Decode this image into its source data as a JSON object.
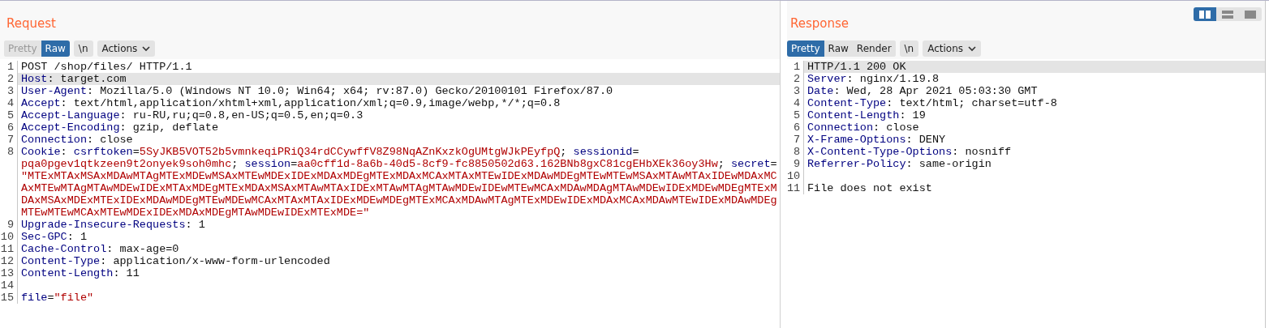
{
  "request": {
    "title": "Request",
    "tabs": [
      {
        "label": "Pretty",
        "selected": false,
        "disabled": true
      },
      {
        "label": "Raw",
        "selected": true,
        "disabled": false
      }
    ],
    "newline_button": "\\n",
    "actions_button": "Actions",
    "lines": [
      {
        "n": "1",
        "highlighted": false,
        "parts": [
          {
            "kind": "plain",
            "t": "POST /shop/files/ HTTP/1.1"
          }
        ]
      },
      {
        "n": "2",
        "highlighted": true,
        "parts": [
          {
            "kind": "name",
            "t": "Host"
          },
          {
            "kind": "plain",
            "t": ": target.com"
          }
        ]
      },
      {
        "n": "3",
        "highlighted": false,
        "parts": [
          {
            "kind": "name",
            "t": "User-Agent"
          },
          {
            "kind": "plain",
            "t": ": Mozilla/5.0 (Windows NT 10.0; Win64; x64; rv:87.0) Gecko/20100101 Firefox/87.0"
          }
        ]
      },
      {
        "n": "4",
        "highlighted": false,
        "parts": [
          {
            "kind": "name",
            "t": "Accept"
          },
          {
            "kind": "plain",
            "t": ": text/html,application/xhtml+xml,application/xml;q=0.9,image/webp,*/*;q=0.8"
          }
        ]
      },
      {
        "n": "5",
        "highlighted": false,
        "parts": [
          {
            "kind": "name",
            "t": "Accept-Language"
          },
          {
            "kind": "plain",
            "t": ": ru-RU,ru;q=0.8,en-US;q=0.5,en;q=0.3"
          }
        ]
      },
      {
        "n": "6",
        "highlighted": false,
        "parts": [
          {
            "kind": "name",
            "t": "Accept-Encoding"
          },
          {
            "kind": "plain",
            "t": ": gzip, deflate"
          }
        ]
      },
      {
        "n": "7",
        "highlighted": false,
        "parts": [
          {
            "kind": "name",
            "t": "Connection"
          },
          {
            "kind": "plain",
            "t": ": close"
          }
        ]
      },
      {
        "n": "8",
        "highlighted": false,
        "parts": [
          {
            "kind": "name",
            "t": "Cookie"
          },
          {
            "kind": "plain",
            "t": ": "
          },
          {
            "kind": "param",
            "t": "csrftoken"
          },
          {
            "kind": "plain",
            "t": "="
          },
          {
            "kind": "value",
            "t": "5SyJKB5VOT52b5vmnkeqiPRiQ34rdCCywffV8Z98NqAZnKxzkOgUMtgWJkPEyfpQ"
          },
          {
            "kind": "plain",
            "t": "; "
          },
          {
            "kind": "param",
            "t": "sessionid"
          },
          {
            "kind": "plain",
            "t": "= "
          },
          {
            "kind": "value",
            "t": "pqa0pgev1qtkzeen9t2onyek9soh0mhc"
          },
          {
            "kind": "plain",
            "t": "; "
          },
          {
            "kind": "param",
            "t": "session"
          },
          {
            "kind": "plain",
            "t": "="
          },
          {
            "kind": "value",
            "t": "aa0cff1d-8a6b-40d5-8cf9-fc8850502d63.162BNb8gxC81cgEHbXEk36oy3Hw"
          },
          {
            "kind": "plain",
            "t": "; "
          },
          {
            "kind": "param",
            "t": "secret"
          },
          {
            "kind": "plain",
            "t": "= "
          },
          {
            "kind": "value",
            "t": "\"MTExMTAxMSAxMDAwMTAgMTExMDEwMSAxMTEwMDExIDExMDAxMDEgMTExMDAxMCAxMTAxMTEwIDExMDAwMDEgMTEwMTEwMSAxMTAwMTAxIDEwMDAxMCAxMTEwMTAgMTAwMDEwIDExMTAxMDEgMTExMDAxMSAxMTAwMTAxIDExMTAwMTAgMTAwMDEwIDEwMTEwMCAxMDAwMDAgMTAwMDEwIDExMDEwMDEgMTExMDAxMSAxMDExMTExIDExMDAwMDEgMTEwMDEwMCAxMTAxMTAxIDExMDEwMDEgMTExMCAxMDAwMTAgMTExMDEwIDExMDAxMCAxMDAwMTEwIDExMDAwMDEgMTEwMTEwMCAxMTEwMDExIDExMDAxMDEgMTAwMDEwIDExMTExMDE=\""
          }
        ]
      },
      {
        "n": "9",
        "highlighted": false,
        "parts": [
          {
            "kind": "name",
            "t": "Upgrade-Insecure-Requests"
          },
          {
            "kind": "plain",
            "t": ": 1"
          }
        ]
      },
      {
        "n": "10",
        "highlighted": false,
        "parts": [
          {
            "kind": "name",
            "t": "Sec-GPC"
          },
          {
            "kind": "plain",
            "t": ": 1"
          }
        ]
      },
      {
        "n": "11",
        "highlighted": false,
        "parts": [
          {
            "kind": "name",
            "t": "Cache-Control"
          },
          {
            "kind": "plain",
            "t": ": max-age=0"
          }
        ]
      },
      {
        "n": "12",
        "highlighted": false,
        "parts": [
          {
            "kind": "name",
            "t": "Content-Type"
          },
          {
            "kind": "plain",
            "t": ": application/x-www-form-urlencoded"
          }
        ]
      },
      {
        "n": "13",
        "highlighted": false,
        "parts": [
          {
            "kind": "name",
            "t": "Content-Length"
          },
          {
            "kind": "plain",
            "t": ": 11"
          }
        ]
      },
      {
        "n": "14",
        "highlighted": false
      },
      {
        "n": "15",
        "highlighted": false,
        "parts": [
          {
            "kind": "param",
            "t": "file"
          },
          {
            "kind": "plain",
            "t": "="
          },
          {
            "kind": "value",
            "t": "\"file\""
          }
        ]
      }
    ]
  },
  "response": {
    "title": "Response",
    "tabs": [
      {
        "label": "Pretty",
        "selected": true,
        "disabled": false
      },
      {
        "label": "Raw",
        "selected": false,
        "disabled": false
      },
      {
        "label": "Render",
        "selected": false,
        "disabled": false
      }
    ],
    "newline_button": "\\n",
    "actions_button": "Actions",
    "lines": [
      {
        "n": "1",
        "highlighted": true,
        "parts": [
          {
            "kind": "plain",
            "t": "HTTP/1.1 200 OK"
          }
        ]
      },
      {
        "n": "2",
        "highlighted": false,
        "parts": [
          {
            "kind": "name",
            "t": "Server"
          },
          {
            "kind": "plain",
            "t": ": nginx/1.19.8"
          }
        ]
      },
      {
        "n": "3",
        "highlighted": false,
        "parts": [
          {
            "kind": "name",
            "t": "Date"
          },
          {
            "kind": "plain",
            "t": ": Wed, 28 Apr 2021 05:03:30 GMT"
          }
        ]
      },
      {
        "n": "4",
        "highlighted": false,
        "parts": [
          {
            "kind": "name",
            "t": "Content-Type"
          },
          {
            "kind": "plain",
            "t": ": text/html; charset=utf-8"
          }
        ]
      },
      {
        "n": "5",
        "highlighted": false,
        "parts": [
          {
            "kind": "name",
            "t": "Content-Length"
          },
          {
            "kind": "plain",
            "t": ": 19"
          }
        ]
      },
      {
        "n": "6",
        "highlighted": false,
        "parts": [
          {
            "kind": "name",
            "t": "Connection"
          },
          {
            "kind": "plain",
            "t": ": close"
          }
        ]
      },
      {
        "n": "7",
        "highlighted": false,
        "parts": [
          {
            "kind": "name",
            "t": "X-Frame-Options"
          },
          {
            "kind": "plain",
            "t": ": DENY"
          }
        ]
      },
      {
        "n": "8",
        "highlighted": false,
        "parts": [
          {
            "kind": "name",
            "t": "X-Content-Type-Options"
          },
          {
            "kind": "plain",
            "t": ": nosniff"
          }
        ]
      },
      {
        "n": "9",
        "highlighted": false,
        "parts": [
          {
            "kind": "name",
            "t": "Referrer-Policy"
          },
          {
            "kind": "plain",
            "t": ": same-origin"
          }
        ]
      },
      {
        "n": "10",
        "highlighted": false
      },
      {
        "n": "11",
        "highlighted": false,
        "parts": [
          {
            "kind": "plain",
            "t": "File does not exist"
          }
        ]
      }
    ]
  },
  "layout_buttons": [
    {
      "kind": "side",
      "selected": true
    },
    {
      "kind": "stacked",
      "selected": false
    },
    {
      "kind": "single",
      "selected": false
    }
  ]
}
